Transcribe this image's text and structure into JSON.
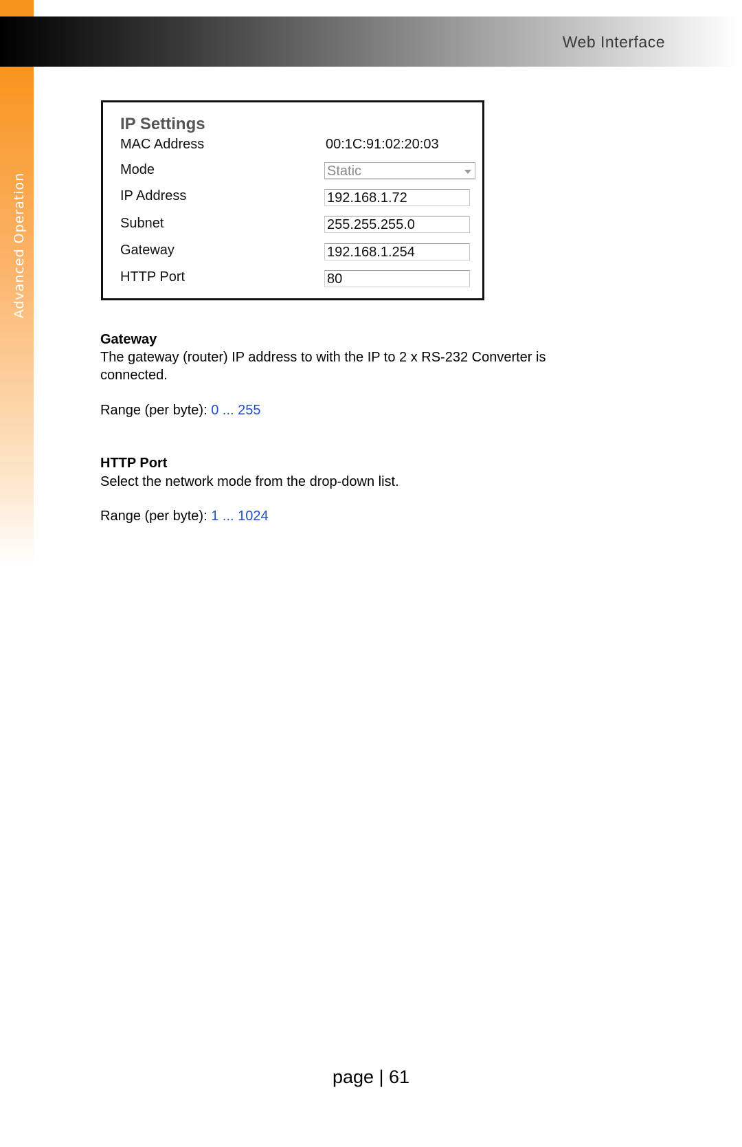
{
  "header": {
    "title": "Web Interface"
  },
  "sidebar": {
    "label": "Advanced Operation"
  },
  "ip_settings": {
    "title": "IP Settings",
    "rows": [
      {
        "label": "MAC Address",
        "value": "00:1C:91:02:20:03"
      },
      {
        "label": "Mode",
        "value": "Static"
      },
      {
        "label": "IP Address",
        "value": "192.168.1.72"
      },
      {
        "label": "Subnet",
        "value": "255.255.255.0"
      },
      {
        "label": "Gateway",
        "value": "192.168.1.254"
      },
      {
        "label": "HTTP Port",
        "value": "80"
      }
    ]
  },
  "sections": [
    {
      "heading": "Gateway",
      "text": "The gateway (router) IP address to with the IP to 2 x RS-232 Converter is connected.",
      "range_label": "Range (per byte):",
      "range_value": "0 ... 255"
    },
    {
      "heading": "HTTP Port",
      "text": "Select the network mode from the drop-down list.",
      "range_label": "Range (per byte):",
      "range_value": "1 ... 1024"
    }
  ],
  "footer": {
    "page": "page | 61"
  },
  "colors": {
    "accent": "#f7941d",
    "link": "#1f4fc8"
  }
}
